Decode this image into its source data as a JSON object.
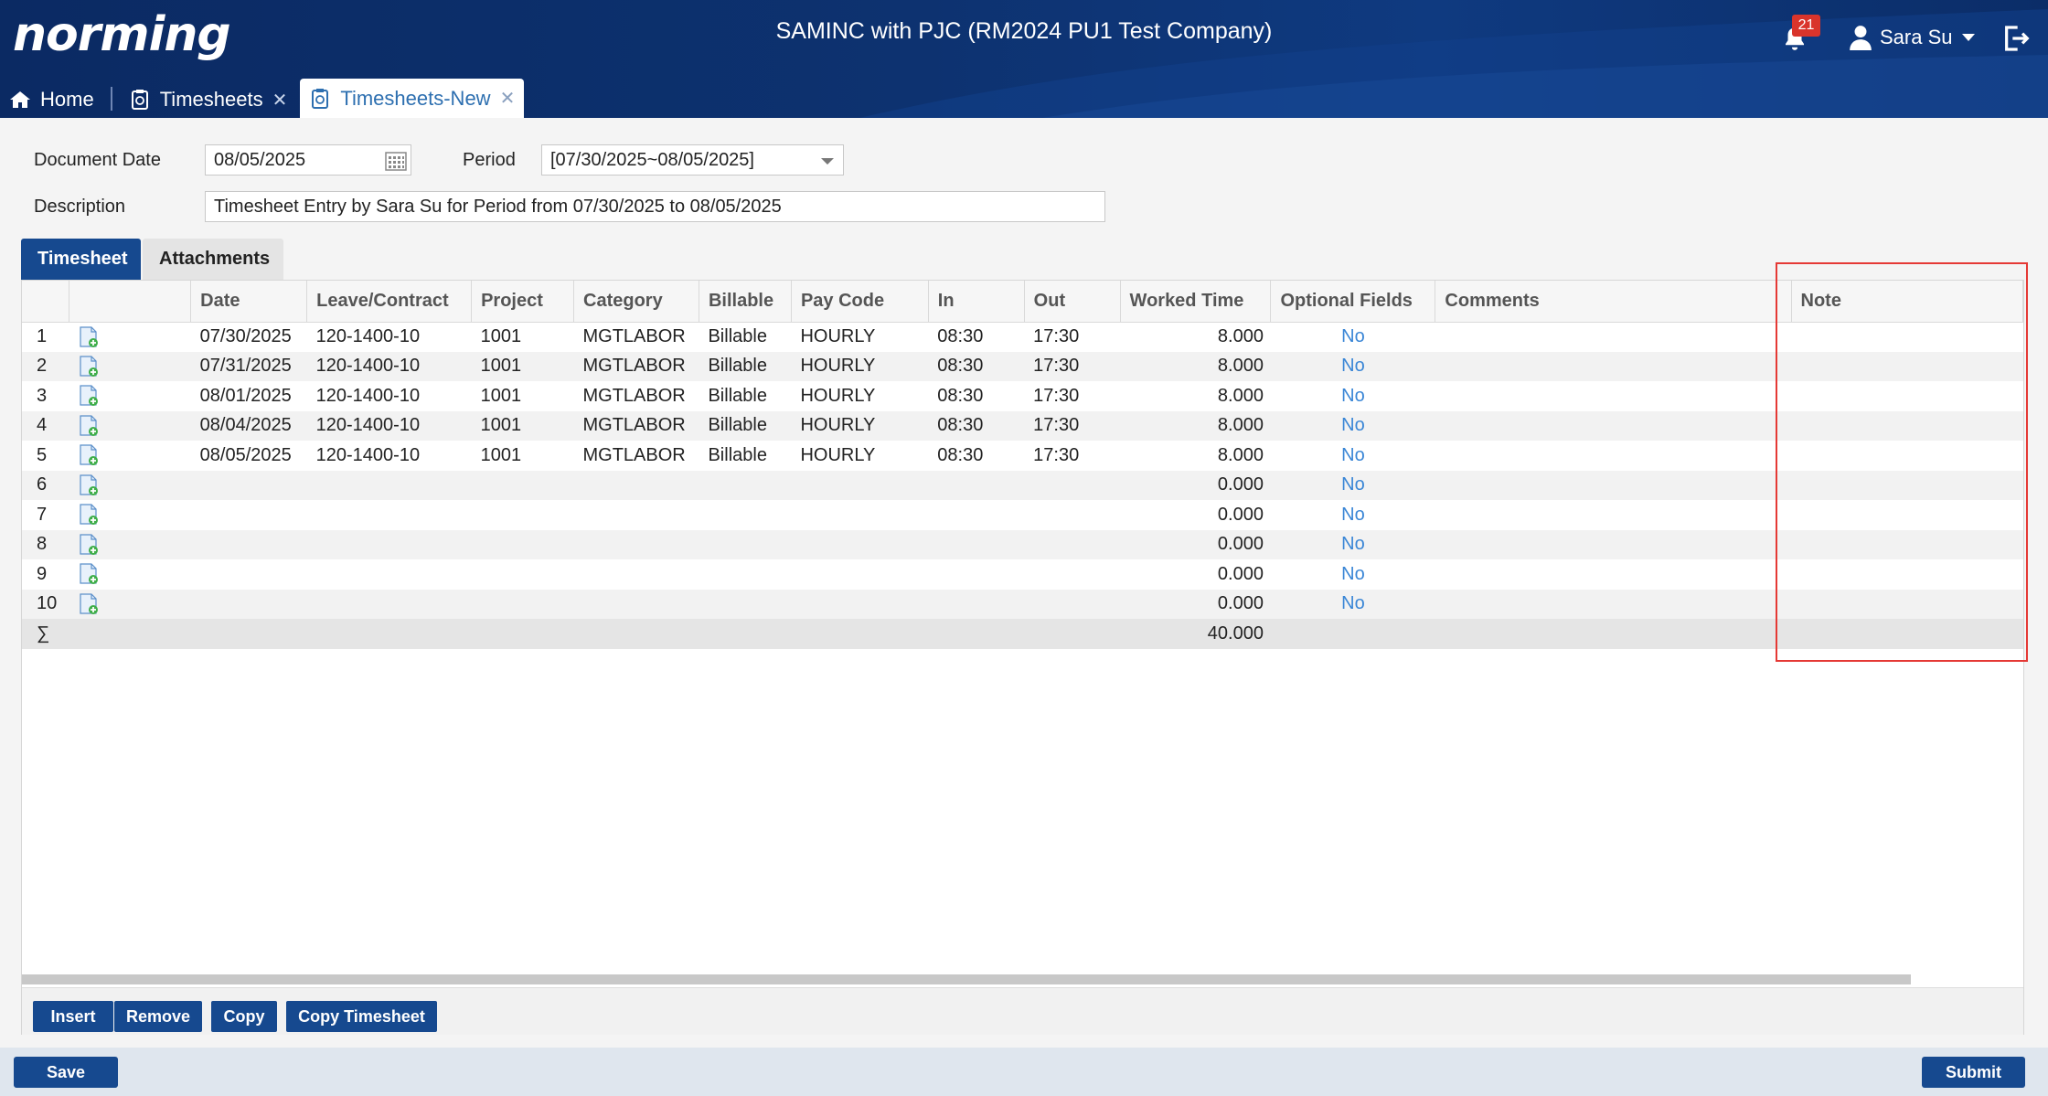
{
  "header": {
    "logo": "norming",
    "company": "SAMINC with PJC (RM2024 PU1 Test Company)",
    "notifications": "21",
    "user": "Sara Su"
  },
  "tabs": [
    {
      "label": "Home",
      "icon": "home-icon"
    },
    {
      "label": "Timesheets",
      "icon": "timesheet-icon",
      "closable": true
    },
    {
      "label": "Timesheets-New",
      "icon": "timesheet-icon",
      "closable": true,
      "active": true
    }
  ],
  "form": {
    "doc_date_label": "Document Date",
    "doc_date": "08/05/2025",
    "period_label": "Period",
    "period": "[07/30/2025~08/05/2025]",
    "description_label": "Description",
    "description": "Timesheet Entry by Sara Su for Period from 07/30/2025 to 08/05/2025"
  },
  "inner_tabs": [
    "Timesheet",
    "Attachments"
  ],
  "grid": {
    "columns": [
      "",
      "",
      "Date",
      "Leave/Contract",
      "Project",
      "Category",
      "Billable",
      "Pay Code",
      "In",
      "Out",
      "Worked Time",
      "Optional Fields",
      "Comments",
      "Note"
    ],
    "rows": [
      [
        "1",
        "07/30/2025",
        "120-1400-10",
        "1001",
        "MGTLABOR",
        "Billable",
        "HOURLY",
        "08:30",
        "17:30",
        "8.000",
        "No",
        "",
        ""
      ],
      [
        "2",
        "07/31/2025",
        "120-1400-10",
        "1001",
        "MGTLABOR",
        "Billable",
        "HOURLY",
        "08:30",
        "17:30",
        "8.000",
        "No",
        "",
        ""
      ],
      [
        "3",
        "08/01/2025",
        "120-1400-10",
        "1001",
        "MGTLABOR",
        "Billable",
        "HOURLY",
        "08:30",
        "17:30",
        "8.000",
        "No",
        "",
        ""
      ],
      [
        "4",
        "08/04/2025",
        "120-1400-10",
        "1001",
        "MGTLABOR",
        "Billable",
        "HOURLY",
        "08:30",
        "17:30",
        "8.000",
        "No",
        "",
        ""
      ],
      [
        "5",
        "08/05/2025",
        "120-1400-10",
        "1001",
        "MGTLABOR",
        "Billable",
        "HOURLY",
        "08:30",
        "17:30",
        "8.000",
        "No",
        "",
        ""
      ],
      [
        "6",
        "",
        "",
        "",
        "",
        "",
        "",
        "",
        "",
        "0.000",
        "No",
        "",
        ""
      ],
      [
        "7",
        "",
        "",
        "",
        "",
        "",
        "",
        "",
        "",
        "0.000",
        "No",
        "",
        ""
      ],
      [
        "8",
        "",
        "",
        "",
        "",
        "",
        "",
        "",
        "",
        "0.000",
        "No",
        "",
        ""
      ],
      [
        "9",
        "",
        "",
        "",
        "",
        "",
        "",
        "",
        "",
        "0.000",
        "No",
        "",
        ""
      ],
      [
        "10",
        "",
        "",
        "",
        "",
        "",
        "",
        "",
        "",
        "0.000",
        "No",
        "",
        ""
      ]
    ],
    "sum_symbol": "∑",
    "total_worked": "40.000"
  },
  "grid_buttons": [
    "Insert",
    "Remove",
    "Copy",
    "Copy Timesheet"
  ],
  "footer": {
    "save": "Save",
    "submit": "Submit"
  },
  "colors": {
    "header": "#0d3270",
    "button": "#16498f",
    "link": "#3a86d6",
    "highlight": "#e53935"
  }
}
